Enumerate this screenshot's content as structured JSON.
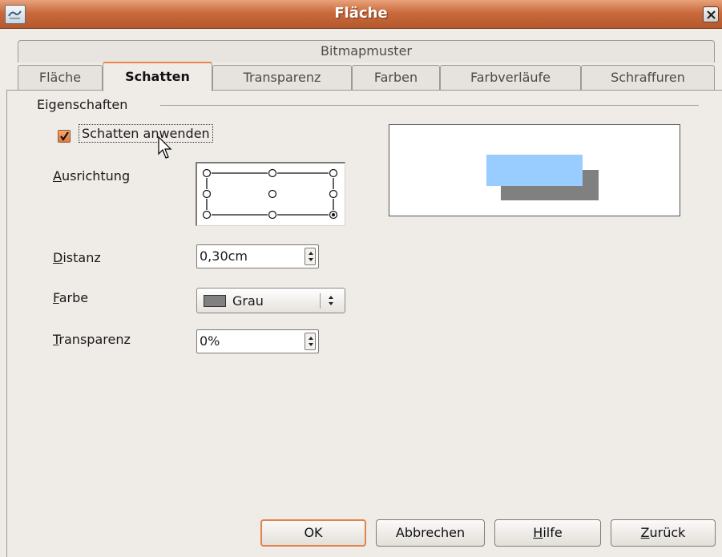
{
  "window": {
    "title": "Fläche",
    "icon": "app-icon",
    "close_icon": "close-icon"
  },
  "tabs": {
    "top_row": [
      "Bitmapmuster"
    ],
    "bottom_row": [
      {
        "label": "Fläche",
        "active": false
      },
      {
        "label": "Schatten",
        "active": true
      },
      {
        "label": "Transparenz",
        "active": false
      },
      {
        "label": "Farben",
        "active": false
      },
      {
        "label": "Farbverläufe",
        "active": false
      },
      {
        "label": "Schraffuren",
        "active": false
      }
    ]
  },
  "properties": {
    "group_title": "Eigenschaften",
    "apply_shadow": {
      "label": "Schatten anwenden",
      "checked": true
    },
    "alignment": {
      "label": "Ausrichtung",
      "selected": "bottom-right"
    },
    "distance": {
      "label": "Distanz",
      "value": "0,30cm"
    },
    "color": {
      "label": "Farbe",
      "value": "Grau",
      "swatch": "#808080"
    },
    "transparency": {
      "label": "Transparenz",
      "value": "0%"
    }
  },
  "preview": {
    "object_color": "#99ccff",
    "shadow_color": "#808080"
  },
  "buttons": {
    "ok": "OK",
    "cancel": "Abbrechen",
    "help": "Hilfe",
    "back": "Zurück"
  },
  "colors": {
    "titlebar": "#c96a3c",
    "accent": "#e0834c",
    "background": "#efebe7"
  }
}
